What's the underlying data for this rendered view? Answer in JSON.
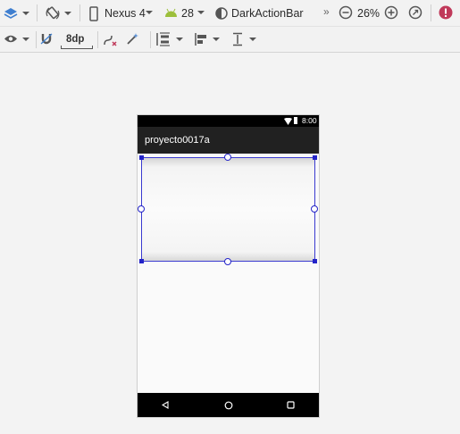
{
  "toolbar_top": {
    "layers_icon": "layers-icon",
    "orientation_icon": "rotate-icon",
    "device": "Nexus 4",
    "api_level": "28",
    "theme": "DarkActionBar",
    "overflow_icon": "double-chevron-right-icon",
    "zoom_level": "26%",
    "error_icon": "error-icon",
    "colors": {
      "api_icon": "#9cbf3b",
      "error": "#c0395a",
      "layers": "#3f7fd0"
    }
  },
  "toolbar_bottom": {
    "eye_icon": "eye-icon",
    "magnet_icon": "magnet-icon",
    "default_margin": "8dp",
    "clear_constraints_icon": "clear-constraints-icon",
    "infer_icon": "magic-wand-icon",
    "pack_icon": "pack-icon",
    "align_icon": "align-icon",
    "guidelines_icon": "guidelines-icon"
  },
  "phone": {
    "status_time": "8:00",
    "app_title": "proyecto0017a",
    "selection_color": "#2323c8"
  }
}
